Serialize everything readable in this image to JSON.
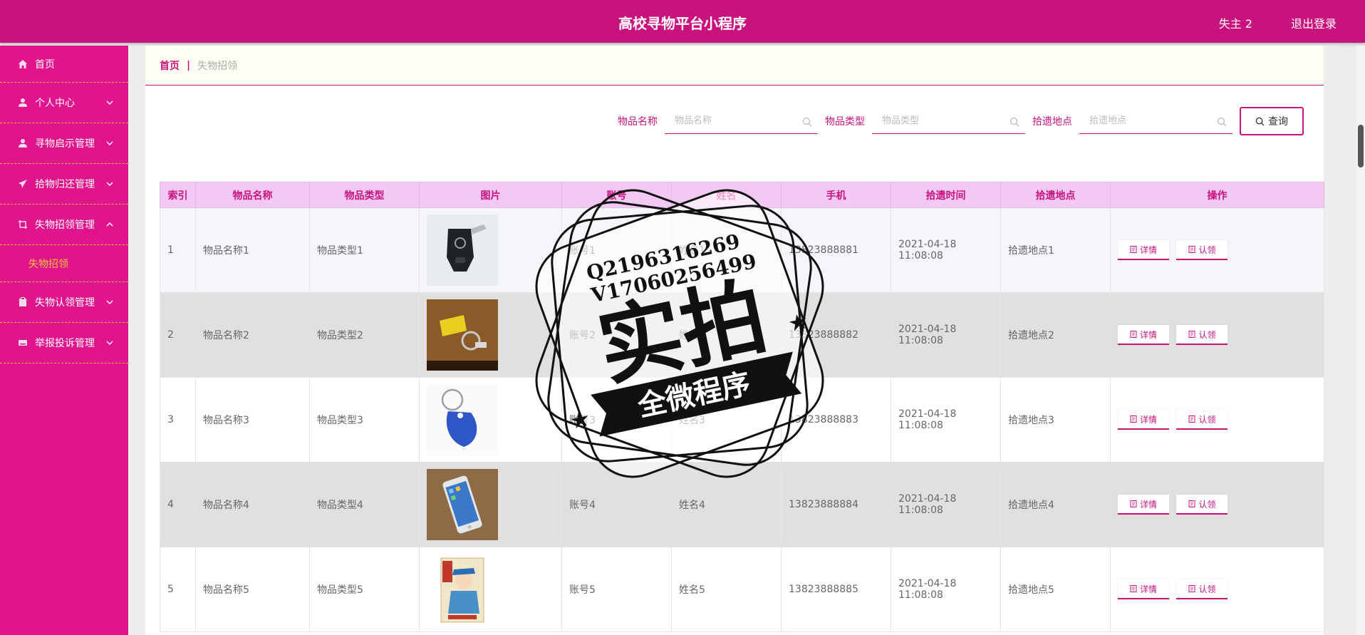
{
  "app": {
    "title": "高校寻物平台小程序",
    "user": "失主 2",
    "logout": "退出登录"
  },
  "colors": {
    "primary": "#c8137e",
    "sidebar": "#e0148c",
    "accent": "#f7c23b",
    "header_row": "#f1c9f3"
  },
  "sidebar": {
    "items": [
      {
        "label": "首页",
        "icon": "home-icon"
      },
      {
        "label": "个人中心",
        "icon": "user-icon"
      },
      {
        "label": "寻物启示管理",
        "icon": "user-icon"
      },
      {
        "label": "拾物归还管理",
        "icon": "paper-plane-icon"
      },
      {
        "label": "失物招领管理",
        "icon": "crop-icon"
      },
      {
        "label": "失物认领管理",
        "icon": "clipboard-icon"
      },
      {
        "label": "举报投诉管理",
        "icon": "hdd-icon"
      }
    ],
    "submenu": {
      "label": "失物招领"
    }
  },
  "breadcrumb": {
    "home": "首页",
    "sep": "|",
    "current": "失物招领"
  },
  "search": {
    "fields": [
      {
        "label": "物品名称",
        "placeholder": "物品名称"
      },
      {
        "label": "物品类型",
        "placeholder": "物品类型"
      },
      {
        "label": "拾遗地点",
        "placeholder": "拾遗地点"
      }
    ],
    "button": "查询"
  },
  "table": {
    "columns": [
      "索引",
      "物品名称",
      "物品类型",
      "图片",
      "账号",
      "姓名",
      "手机",
      "拾遗时间",
      "拾遗地点",
      "操作"
    ],
    "rows": [
      {
        "index": "1",
        "name": "物品名称1",
        "type": "物品类型1",
        "image": "car-key",
        "account": "账号1",
        "realname": "姓名1",
        "phone": "13823888881",
        "time": "2021-04-18 11:08:08",
        "place": "拾遗地点1"
      },
      {
        "index": "2",
        "name": "物品名称2",
        "type": "物品类型2",
        "image": "usb-keychain",
        "account": "账号2",
        "realname": "姓名2",
        "phone": "13823888882",
        "time": "2021-04-18 11:08:08",
        "place": "拾遗地点2"
      },
      {
        "index": "3",
        "name": "物品名称3",
        "type": "物品类型3",
        "image": "key-fob",
        "account": "账号3",
        "realname": "姓名3",
        "phone": "13823888883",
        "time": "2021-04-18 11:08:08",
        "place": "拾遗地点3"
      },
      {
        "index": "4",
        "name": "物品名称4",
        "type": "物品类型4",
        "image": "smartphone",
        "account": "账号4",
        "realname": "姓名4",
        "phone": "13823888884",
        "time": "2021-04-18 11:08:08",
        "place": "拾遗地点4"
      },
      {
        "index": "5",
        "name": "物品名称5",
        "type": "物品类型5",
        "image": "book",
        "account": "账号5",
        "realname": "姓名5",
        "phone": "13823888885",
        "time": "2021-04-18 11:08:08",
        "place": "拾遗地点5"
      }
    ],
    "actions": {
      "detail": "详情",
      "claim": "认领"
    }
  },
  "watermark": {
    "line1": "Q2196316269",
    "line2": "V17060256499",
    "big": "实拍",
    "ribbon": "全微程序"
  }
}
